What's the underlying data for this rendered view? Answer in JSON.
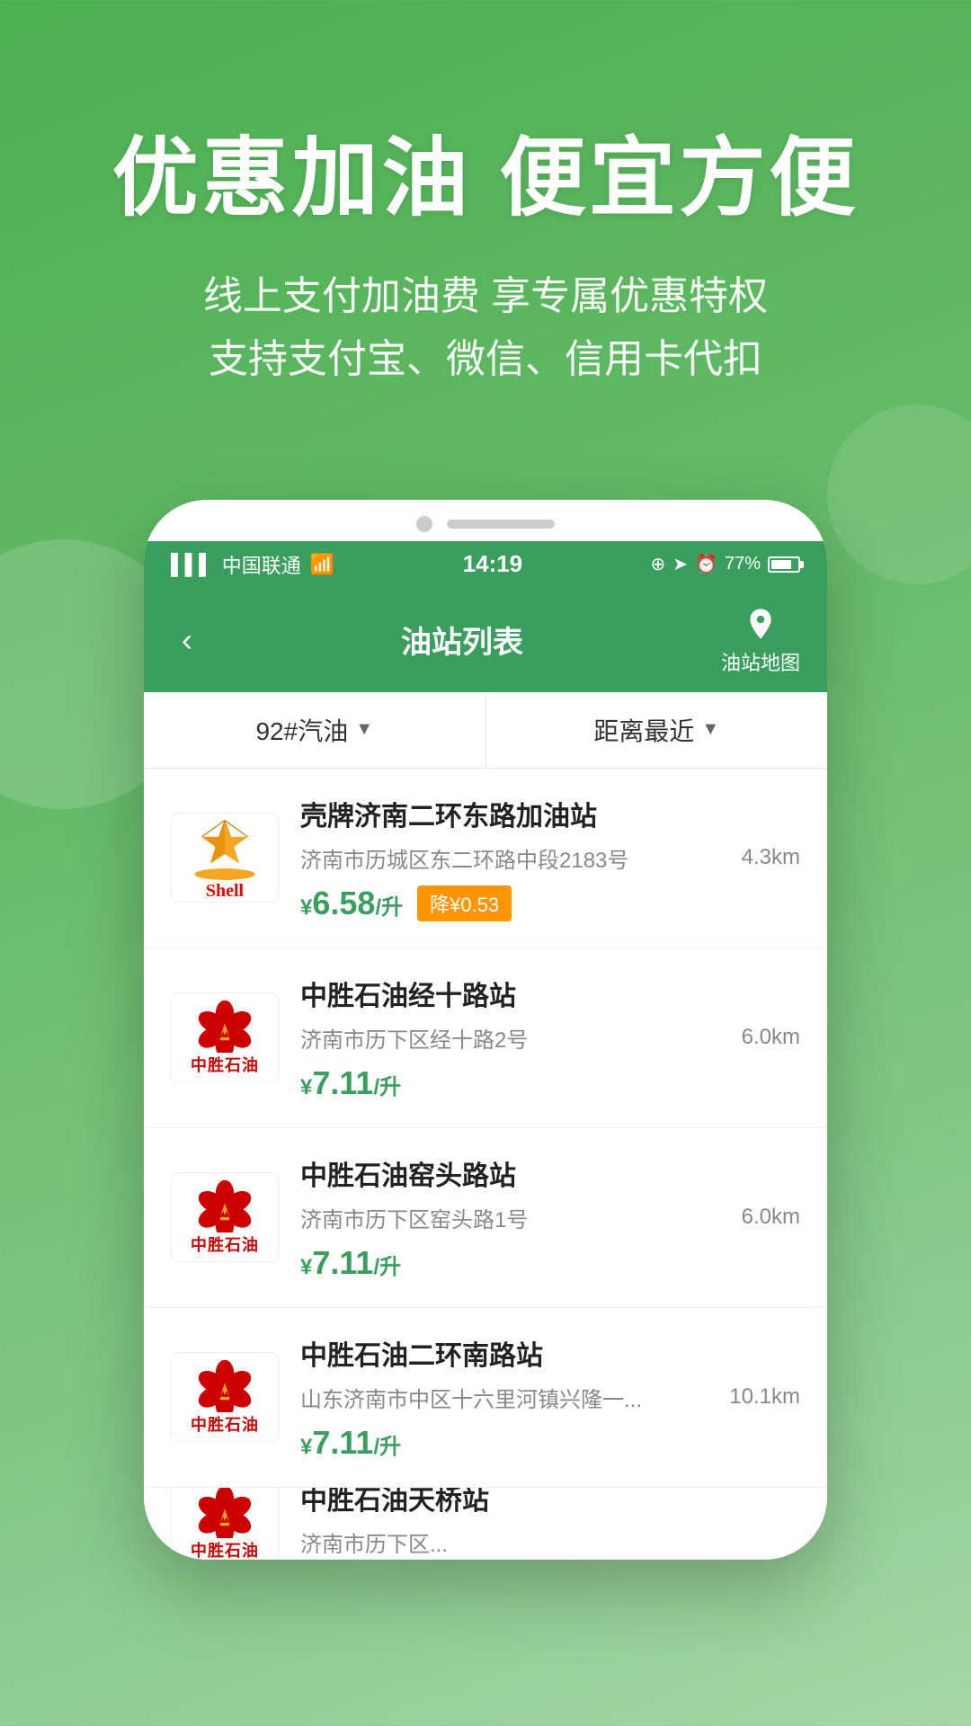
{
  "hero": {
    "title": "优惠加油 便宜方便",
    "subtitle_line1": "线上支付加油费 享专属优惠特权",
    "subtitle_line2": "支持支付宝、微信、信用卡代扣"
  },
  "status_bar": {
    "carrier": "中国联通",
    "time": "14:19",
    "battery": "77%"
  },
  "header": {
    "back_label": "‹",
    "title": "油站列表",
    "map_label": "油站地图"
  },
  "filters": {
    "fuel_type": "92#汽油",
    "sort": "距离最近"
  },
  "stations": [
    {
      "id": 1,
      "brand": "Shell",
      "name": "壳牌济南二环东路加油站",
      "address": "济南市历城区东二环路中段2183号",
      "distance": "4.3km",
      "price": "6.58",
      "unit": "/升",
      "discount": "降¥0.53",
      "has_discount": true
    },
    {
      "id": 2,
      "brand": "中胜石油",
      "name": "中胜石油经十路站",
      "address": "济南市历下区经十路2号",
      "distance": "6.0km",
      "price": "7.11",
      "unit": "/升",
      "has_discount": false
    },
    {
      "id": 3,
      "brand": "中胜石油",
      "name": "中胜石油窑头路站",
      "address": "济南市历下区窑头路1号",
      "distance": "6.0km",
      "price": "7.11",
      "unit": "/升",
      "has_discount": false
    },
    {
      "id": 4,
      "brand": "中胜石油",
      "name": "中胜石油二环南路站",
      "address": "山东济南市中区十六里河镇兴隆一...",
      "distance": "10.1km",
      "price": "7.11",
      "unit": "/升",
      "has_discount": false
    },
    {
      "id": 5,
      "brand": "中胜石油",
      "name": "中胜石油天桥站",
      "address": "济南市历下区...",
      "distance": "",
      "price": "",
      "unit": "",
      "has_discount": false,
      "partial": true
    }
  ]
}
